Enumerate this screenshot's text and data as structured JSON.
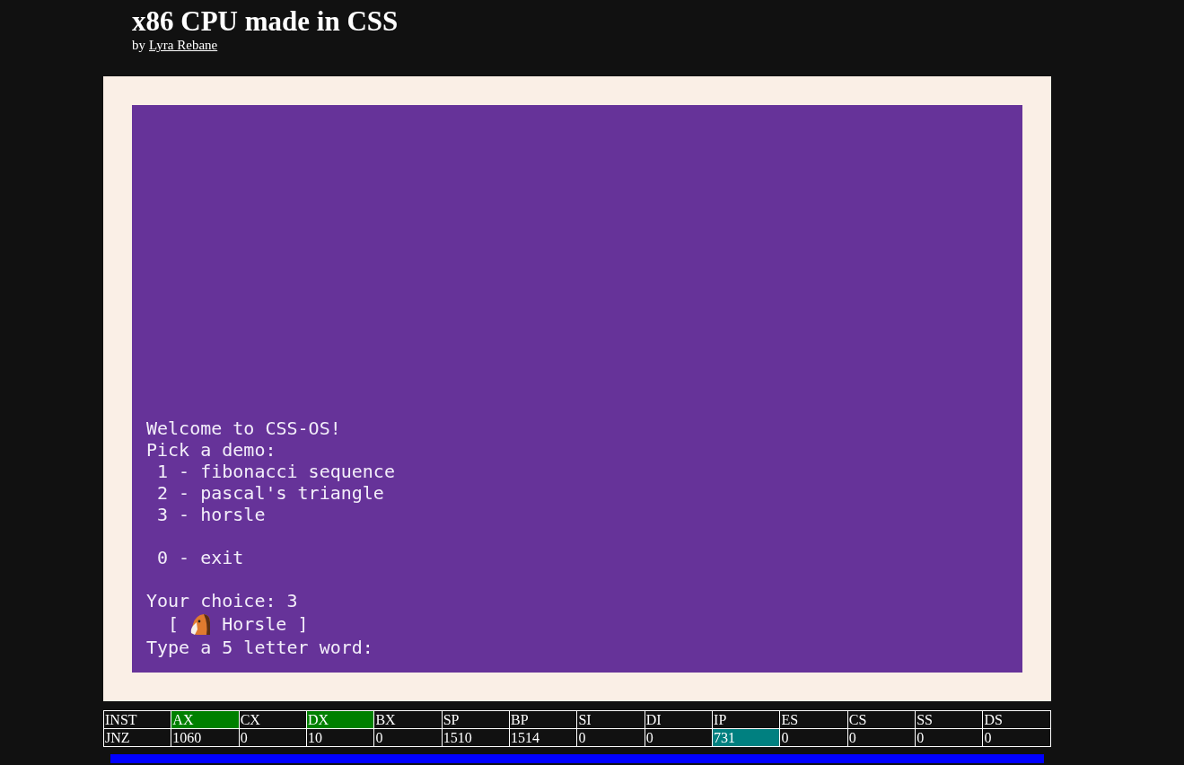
{
  "header": {
    "title": "x86 CPU made in CSS",
    "byline": "by",
    "author_link": "Lyra Rebane"
  },
  "screen": {
    "lines": [
      {
        "kind": "text",
        "text": "Welcome to CSS-OS!"
      },
      {
        "kind": "text",
        "text": "Pick a demo:"
      },
      {
        "kind": "text",
        "text": " 1 - fibonacci sequence"
      },
      {
        "kind": "text",
        "text": " 2 - pascal's triangle"
      },
      {
        "kind": "text",
        "text": " 3 - horsle"
      },
      {
        "kind": "blank"
      },
      {
        "kind": "text",
        "text": " 0 - exit"
      },
      {
        "kind": "blank"
      },
      {
        "kind": "text",
        "text": "Your choice: 3"
      },
      {
        "kind": "icon",
        "prefix": "  [",
        "suffix": "Horsle ]"
      },
      {
        "kind": "text",
        "text": "Type a 5 letter word:"
      }
    ]
  },
  "registers": [
    {
      "name": "INST",
      "value": "JNZ",
      "changed": false,
      "active": false
    },
    {
      "name": "AX",
      "value": "1060",
      "changed": true,
      "active": false
    },
    {
      "name": "CX",
      "value": "0",
      "changed": false,
      "active": false
    },
    {
      "name": "DX",
      "value": "10",
      "changed": true,
      "active": false
    },
    {
      "name": "BX",
      "value": "0",
      "changed": false,
      "active": false
    },
    {
      "name": "SP",
      "value": "1510",
      "changed": false,
      "active": false
    },
    {
      "name": "BP",
      "value": "1514",
      "changed": false,
      "active": false
    },
    {
      "name": "SI",
      "value": "0",
      "changed": false,
      "active": false
    },
    {
      "name": "DI",
      "value": "0",
      "changed": false,
      "active": false
    },
    {
      "name": "IP",
      "value": "731",
      "changed": false,
      "active": true
    },
    {
      "name": "ES",
      "value": "0",
      "changed": false,
      "active": false
    },
    {
      "name": "CS",
      "value": "0",
      "changed": false,
      "active": false
    },
    {
      "name": "SS",
      "value": "0",
      "changed": false,
      "active": false
    },
    {
      "name": "DS",
      "value": "0",
      "changed": false,
      "active": false
    }
  ]
}
